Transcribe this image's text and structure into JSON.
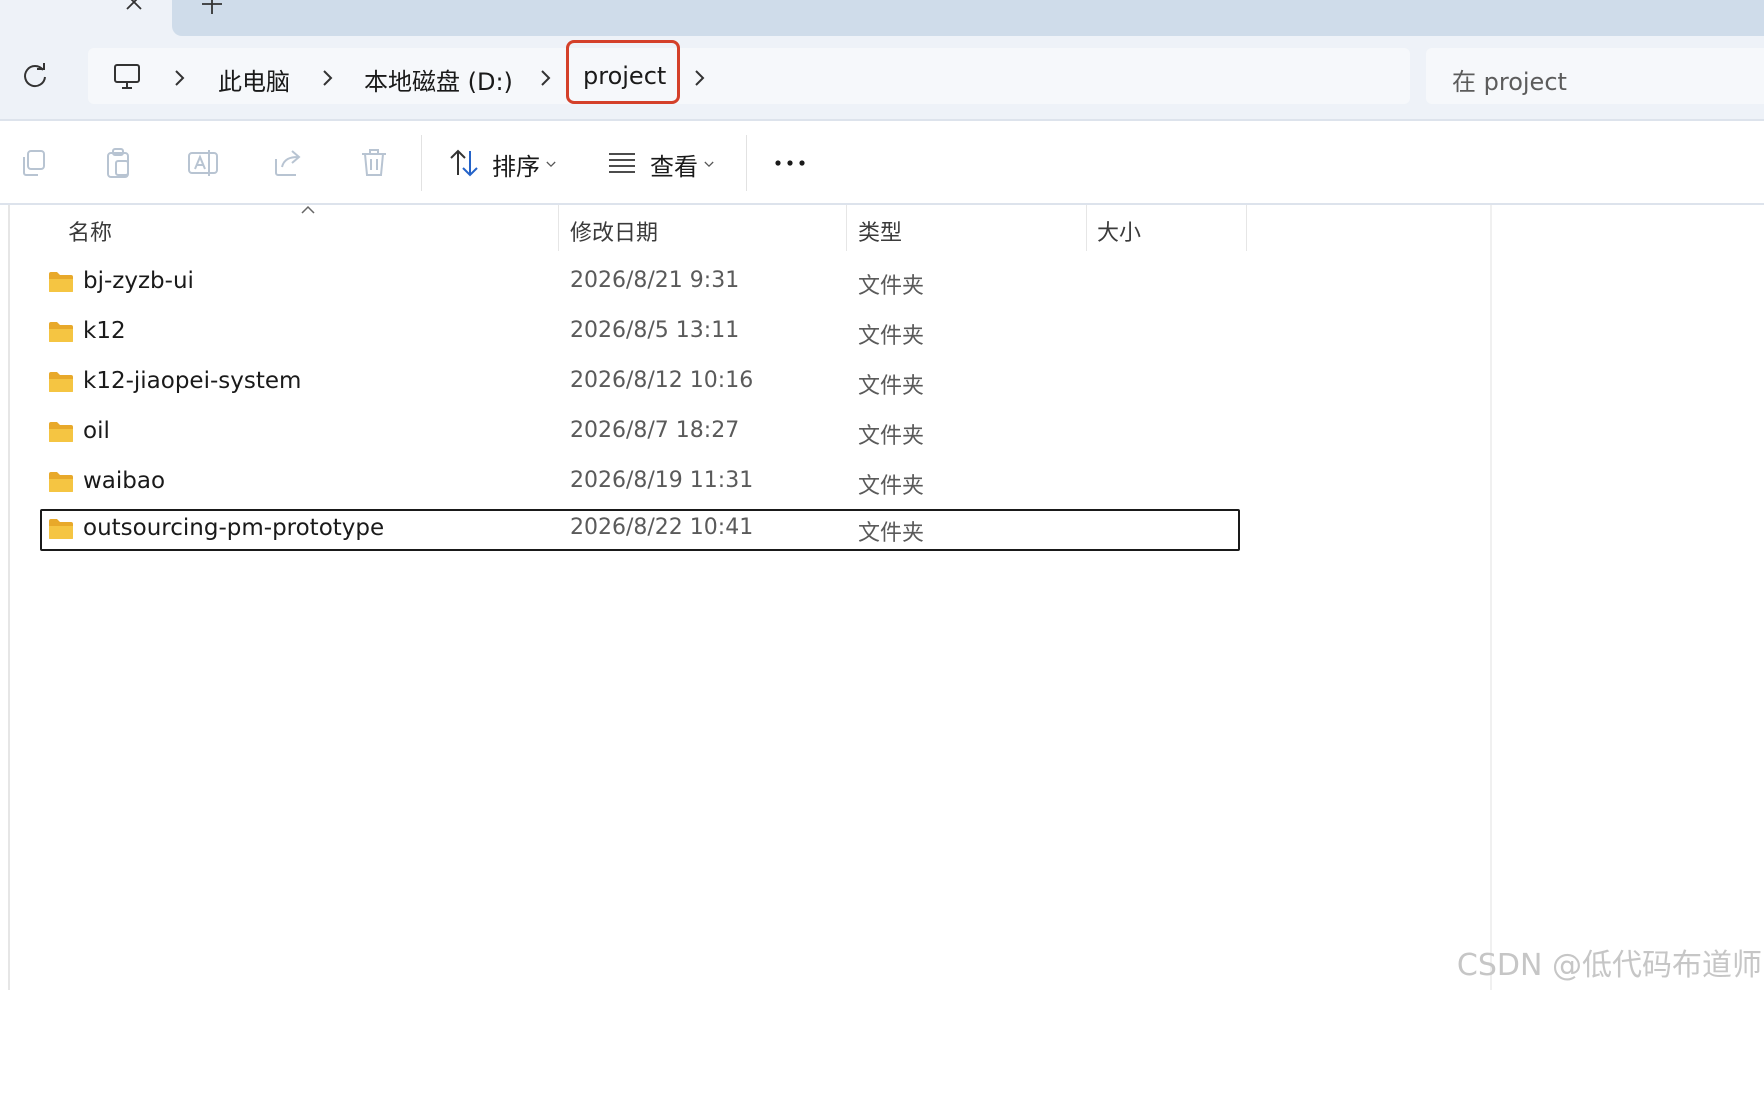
{
  "breadcrumb": {
    "items": [
      "此电脑",
      "本地磁盘 (D:)",
      "project"
    ]
  },
  "search": {
    "placeholder": "在 project"
  },
  "toolbar": {
    "sort_label": "排序",
    "view_label": "查看"
  },
  "columns": {
    "name": "名称",
    "date": "修改日期",
    "type": "类型",
    "size": "大小"
  },
  "files": [
    {
      "name": "bj-zyzb-ui",
      "date": "2026/8/21 9:31",
      "type": "文件夹",
      "size": ""
    },
    {
      "name": "k12",
      "date": "2026/8/5 13:11",
      "type": "文件夹",
      "size": ""
    },
    {
      "name": "k12-jiaopei-system",
      "date": "2026/8/12 10:16",
      "type": "文件夹",
      "size": ""
    },
    {
      "name": "oil",
      "date": "2026/8/7 18:27",
      "type": "文件夹",
      "size": ""
    },
    {
      "name": "waibao",
      "date": "2026/8/19 11:31",
      "type": "文件夹",
      "size": ""
    },
    {
      "name": "outsourcing-pm-prototype",
      "date": "2026/8/22 10:41",
      "type": "文件夹",
      "size": ""
    }
  ],
  "selected_index": 5,
  "highlighted_crumb": "project",
  "colors": {
    "highlight": "#d4402a",
    "folder": "#f5c542"
  },
  "watermark": "CSDN @低代码布道师"
}
